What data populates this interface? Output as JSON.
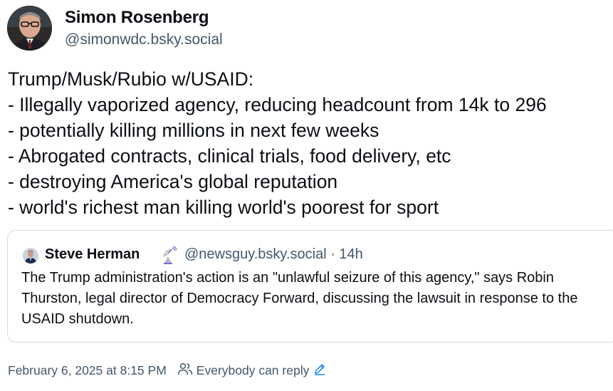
{
  "author": {
    "name": "Simon Rosenberg",
    "handle": "@simonwdc.bsky.social"
  },
  "post": {
    "text": "Trump/Musk/Rubio w/USAID:\n- Illegally vaporized agency, reducing headcount from 14k to 296\n- potentially killing millions in next few weeks\n- Abrogated contracts, clinical trials, food delivery, etc\n- destroying America's global reputation\n- world's richest man killing world's poorest for sport"
  },
  "quote": {
    "author_name": "Steve Herman",
    "badge_icon": "satellite-dish-icon",
    "handle_time": "@newsguy.bsky.social · 14h",
    "text": "The Trump administration's action is an \"unlawful seizure of this agency,\" says Robin Thurston, legal director of Democracy Forward, discussing the lawsuit in response to the USAID shutdown."
  },
  "footer": {
    "timestamp": "February 6, 2025 at 8:15 PM",
    "reply_setting": "Everybody can reply",
    "icons": [
      "people-icon",
      "pencil-icon"
    ],
    "accent_color": "#1083fe"
  }
}
